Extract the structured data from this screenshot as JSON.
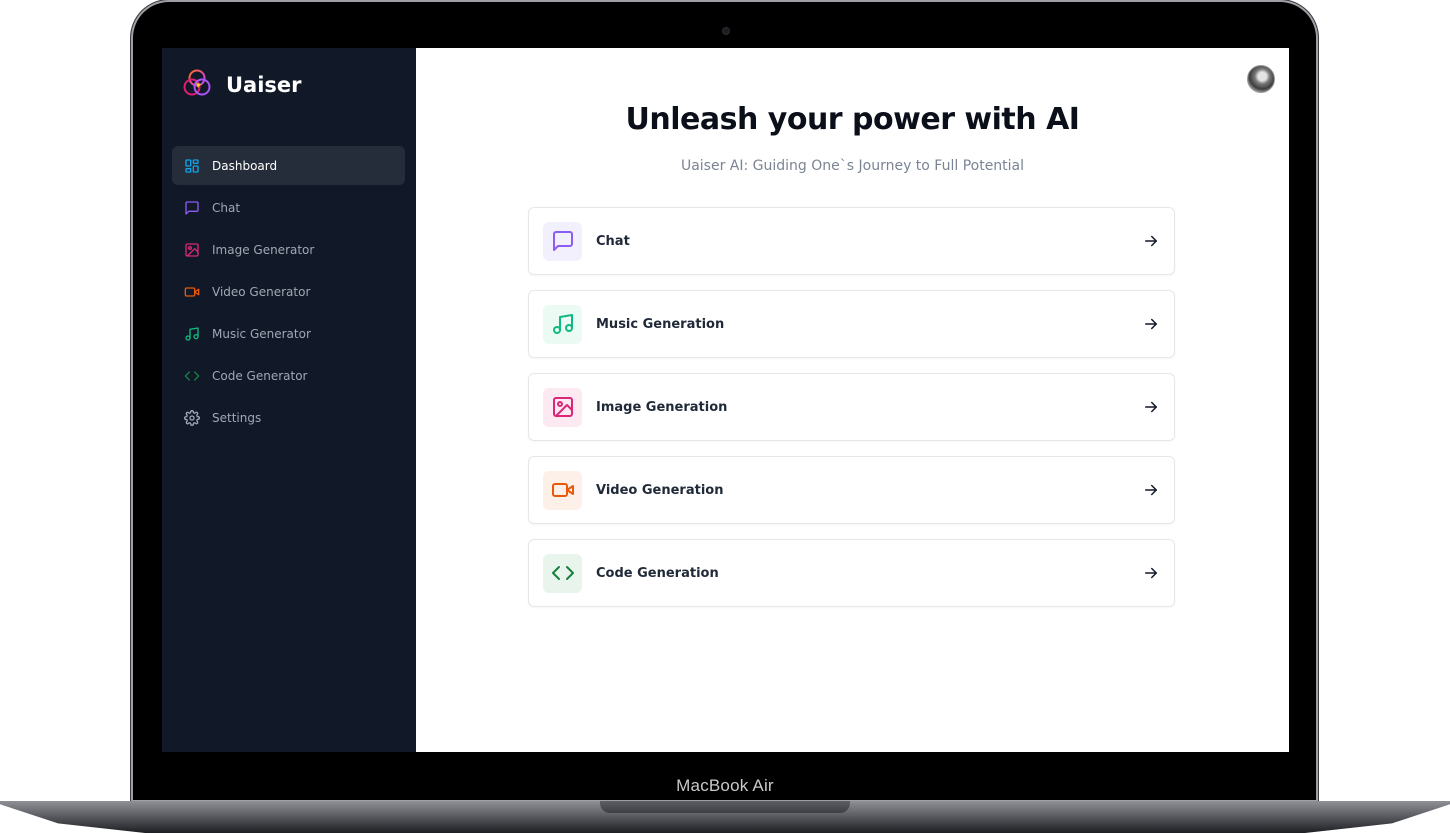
{
  "device": {
    "label": "MacBook Air"
  },
  "brand": {
    "name": "Uaiser"
  },
  "sidebar": {
    "items": [
      {
        "label": "Dashboard",
        "icon": "dashboard-icon",
        "color": "#0ea5e9",
        "active": true
      },
      {
        "label": "Chat",
        "icon": "chat-icon",
        "color": "#8b5cf6"
      },
      {
        "label": "Image Generator",
        "icon": "image-icon",
        "color": "#db2777"
      },
      {
        "label": "Video Generator",
        "icon": "video-icon",
        "color": "#ea580c"
      },
      {
        "label": "Music Generator",
        "icon": "music-icon",
        "color": "#10b981"
      },
      {
        "label": "Code Generator",
        "icon": "code-icon",
        "color": "#15803d"
      },
      {
        "label": "Settings",
        "icon": "gear-icon",
        "color": "#a1a7b3"
      }
    ]
  },
  "main": {
    "title": "Unleash your power with AI",
    "subtitle": "Uaiser AI: Guiding One`s Journey to Full Potential",
    "cards": [
      {
        "label": "Chat",
        "icon": "chat-icon",
        "color": "#8b5cf6",
        "bg": "#f3f0fe"
      },
      {
        "label": "Music Generation",
        "icon": "music-icon",
        "color": "#10b981",
        "bg": "#ebfaf3"
      },
      {
        "label": "Image Generation",
        "icon": "image-icon",
        "color": "#db2777",
        "bg": "#fde9f1"
      },
      {
        "label": "Video Generation",
        "icon": "video-icon",
        "color": "#ea580c",
        "bg": "#fdf0e8"
      },
      {
        "label": "Code Generation",
        "icon": "code-icon",
        "color": "#15803d",
        "bg": "#e8f4ec"
      }
    ]
  },
  "colors": {
    "sidebar_bg": "#111827",
    "active_bg": "#262d3a",
    "title": "#0b0f19"
  }
}
